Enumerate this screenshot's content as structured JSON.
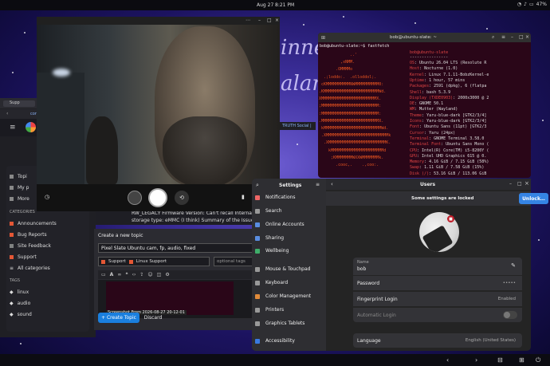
{
  "topbar": {
    "date": "Aug 27",
    "time": "8:21 PM",
    "battery": "47%"
  },
  "wallpaper": {
    "text1": "inne",
    "text2": "alan"
  },
  "browser": {
    "tab_label": "Supp",
    "toolbar_text": "con",
    "bookmark": "TRUTH Social |"
  },
  "forum": {
    "sidebar": {
      "items": [
        "Topi",
        "My p",
        "More"
      ],
      "categories_header": "CATEGORIES",
      "categories": [
        {
          "label": "Announcements",
          "color": "#e45735"
        },
        {
          "label": "Bug Reports",
          "color": "#e45735"
        },
        {
          "label": "Site Feedback",
          "color": "#808281"
        },
        {
          "label": "Support",
          "color": "#e45735"
        }
      ],
      "all_categories": "All categories",
      "tags_header": "TAGS",
      "tags": [
        "linux",
        "audio",
        "sound"
      ]
    },
    "post_lines": [
      "RW_LEGACY Firmware Version: Can't recall Internal",
      "storage type: eMMC (I think) Summary of the Issue I w"
    ],
    "composer": {
      "header": "Create a new topic",
      "title_value": "Pixel Slate Ubuntu cam, fp, audio, fixed",
      "category1": "Support",
      "category2": "Linux Support",
      "tags_placeholder": "optional tags",
      "screenshot_caption": "Screenshot From 2026-08-27 20-12-01",
      "create_label": "+ Create Topic",
      "discard_label": "Discard"
    }
  },
  "terminal": {
    "title": "bob@ubuntu-slate: ~",
    "prompt": "bob@ubuntu-slate:~$ fastfetch",
    "userhost": "bob@ubuntu-slate",
    "separator": "----------------",
    "info": [
      {
        "k": "OS",
        "v": ": Ubuntu 26.04 LTS (Resolute R"
      },
      {
        "k": "Host",
        "v": ": Nocturne (1.0)"
      },
      {
        "k": "Kernel",
        "v": ": Linux 7.1.11-BobzKernel-e"
      },
      {
        "k": "Uptime",
        "v": ": 1 hour, 57 mins"
      },
      {
        "k": "Packages",
        "v": ": 2591 (dpkg), 6 (flatpa"
      },
      {
        "k": "Shell",
        "v": ": bash 5.3.9"
      },
      {
        "k": "Display (TXDE0903)",
        "v": ": 2000x3000 @ 2"
      },
      {
        "k": "DE",
        "v": ": GNOME 50.1"
      },
      {
        "k": "WM",
        "v": ": Mutter (Wayland)"
      },
      {
        "k": "Theme",
        "v": ": Yaru-blue-dark [GTK2/3/4]"
      },
      {
        "k": "Icons",
        "v": ": Yaru-blue-dark [GTK2/3/4]"
      },
      {
        "k": "Font",
        "v": ": Ubuntu Sans (11pt) [GTK2/3"
      },
      {
        "k": "Cursor",
        "v": ": Yaru (24px)"
      },
      {
        "k": "Terminal",
        "v": ": GNOME Terminal 3.58.0"
      },
      {
        "k": "Terminal Font",
        "v": ": Ubuntu Sans Mono ("
      },
      {
        "k": "CPU",
        "v": ": Intel(R) Core(TM) i5-8200Y ("
      },
      {
        "k": "GPU",
        "v": ": Intel UHD Graphics 615 @ 0."
      },
      {
        "k": "Memory",
        "v": ": 4.16 GiB / 7.15 GiB (58%)"
      },
      {
        "k": "Swap",
        "v": ": 1.11 GiB / 7.58 GiB (15%)"
      },
      {
        "k": "Disk (/)",
        "v": ": 53.16 GiB / 113.06 GiB"
      }
    ],
    "logo_lines": [
      "             ..'",
      "         ,xNMM.",
      "       .OMMMMo",
      "  .;loddo:.  .olloddol;.",
      " cKMMMMMMMMMMNWMMMMMMMMMM0:",
      ".KMMMMMMMMMMMMMMMMMMMMMMMWd.",
      "XMMMMMMMMMMMMMMMMMMMMMMMX.",
      ";MMMMMMMMMMMMMMMMMMMMMMMM:",
      ":MMMMMMMMMMMMMMMMMMMMMMMM:",
      ".MMMMMMMMMMMMMMMMMMMMMMMMX.",
      " kMMMMMMMMMMMMMMMMMMMMMMMMWd.",
      " .XMMMMMMMMMMMMMMMMMMMMMMMMMMk",
      "  .XMMMMMMMMMMMMMMMMMMMMMMMMK.",
      "    kMMMMMMMMMMMMMMMMMMMMMMd",
      "     ;KMMMMMMMWXXWMMMMMMMk.",
      "       .cooc,.    .,coo:."
    ]
  },
  "settings": {
    "title": "Settings",
    "items": [
      {
        "label": "Notifications",
        "color": "#e66"
      },
      {
        "label": "Search",
        "color": "#999"
      },
      {
        "label": "Online Accounts",
        "color": "#5a8de0"
      },
      {
        "label": "Sharing",
        "color": "#5a8de0"
      },
      {
        "label": "Wellbeing",
        "color": "#3fae6a"
      },
      {
        "label": "Mouse & Touchpad",
        "color": "#999"
      },
      {
        "label": "Keyboard",
        "color": "#999"
      },
      {
        "label": "Color Management",
        "color": "#e08a3a"
      },
      {
        "label": "Printers",
        "color": "#999"
      },
      {
        "label": "Graphics Tablets",
        "color": "#999"
      },
      {
        "label": "Accessibility",
        "color": "#3a7ae0"
      },
      {
        "label": "Privacy & Security",
        "color": "#999"
      }
    ]
  },
  "users": {
    "title": "Users",
    "locked_text": "Some settings are locked",
    "unlock_label": "Unlock…",
    "name_label": "Name",
    "name_value": "bob",
    "password_label": "Password",
    "password_value": "•••••",
    "fingerprint_label": "Fingerprint Login",
    "fingerprint_value": "Enabled",
    "autologin_label": "Automatic Login",
    "language_label": "Language",
    "language_value": "English (United States)"
  }
}
